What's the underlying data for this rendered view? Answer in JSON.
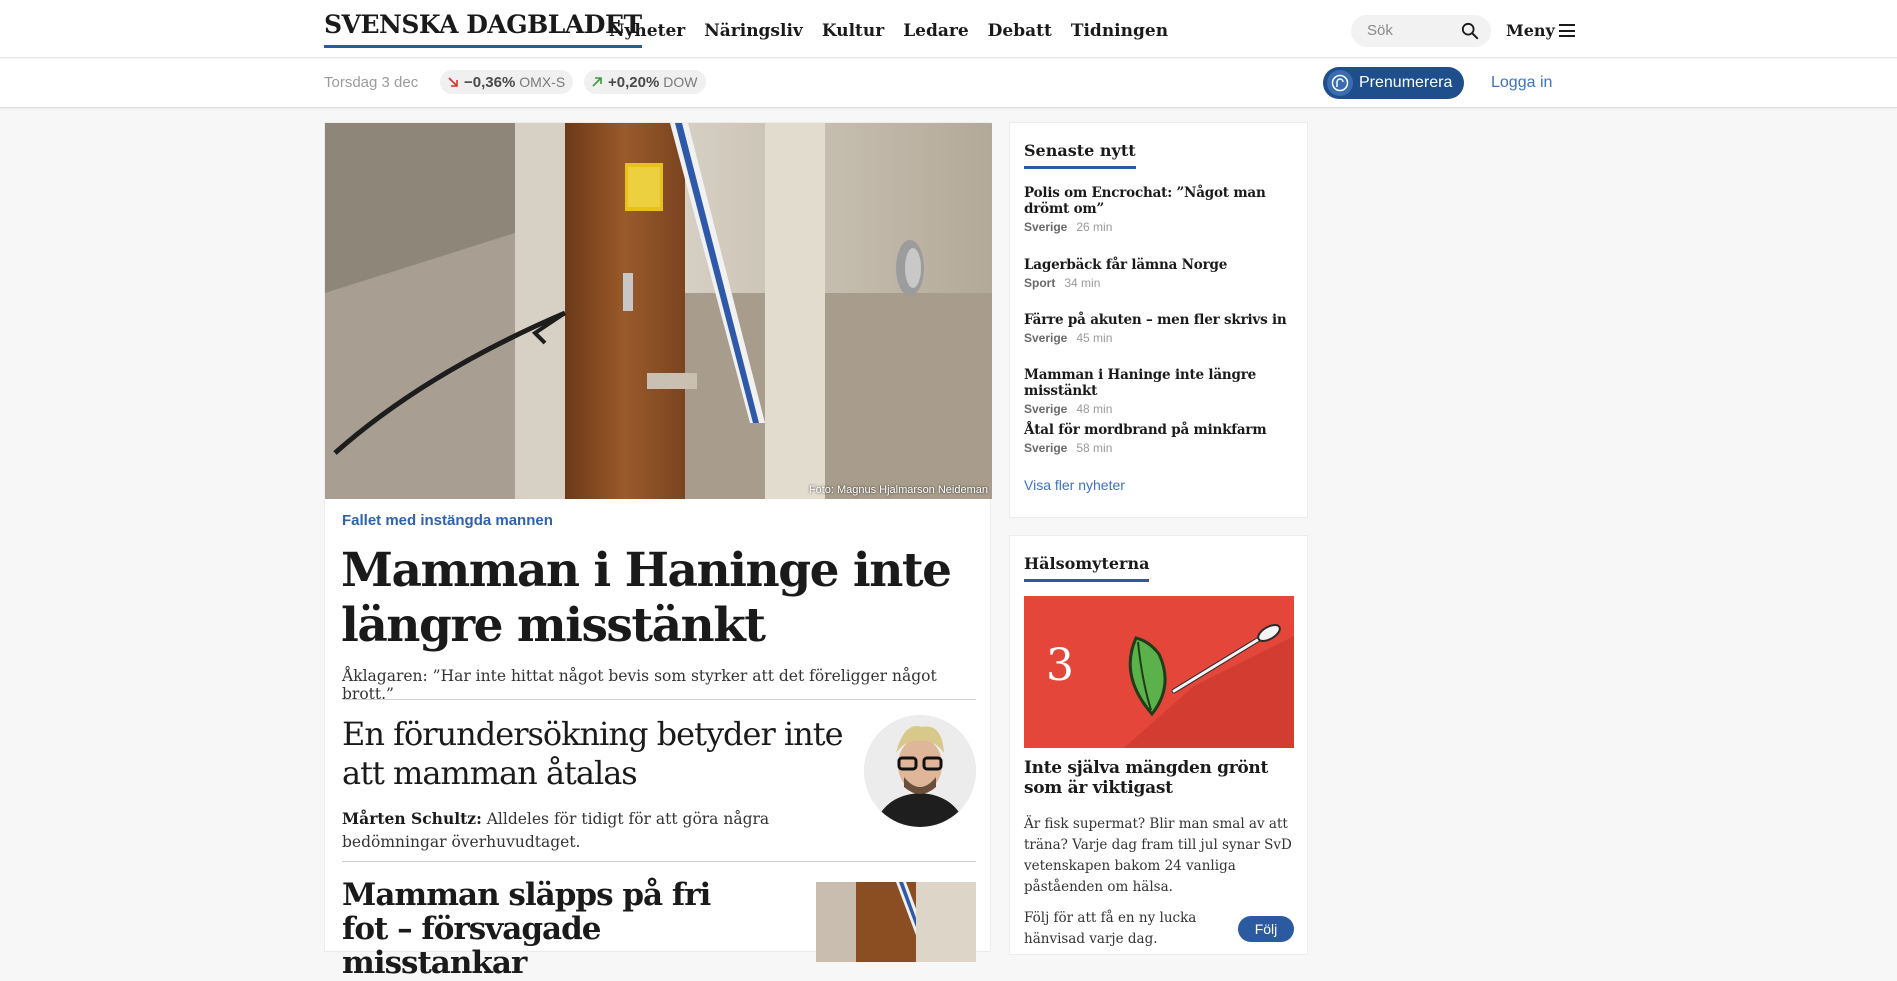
{
  "header": {
    "logo": "SVENSKA DAGBLADET",
    "nav": [
      "Nyheter",
      "Näringsliv",
      "Kultur",
      "Ledare",
      "Debatt",
      "Tidningen"
    ],
    "search_placeholder": "Sök",
    "menu_label": "Meny"
  },
  "subbar": {
    "date": "Torsdag 3 dec",
    "tickers": [
      {
        "value": "−0,36%",
        "name": "OMX-S",
        "direction": "down",
        "color": "#d0342c"
      },
      {
        "value": "+0,20%",
        "name": "DOW",
        "direction": "up",
        "color": "#3a9a3a"
      }
    ],
    "subscribe_label": "Prenumerera",
    "login_label": "Logga in"
  },
  "main": {
    "photo_credit": "Foto: Magnus Hjalmarson Neideman",
    "kicker": "Fallet med instängda mannen",
    "headline": "Mamman i Haninge inte längre misstänkt",
    "lead": "Åklagaren: ”Har inte hittat något bevis som styrker att det föreligger något brott.”",
    "sub_headline": "En förundersökning betyder inte att mamman åtalas",
    "sub_author": "Mårten Schultz:",
    "sub_lead": " Alldeles för tidigt för att göra några bedömningar överhuvudtaget.",
    "third_headline": "Mamman släpps på fri fot – försvagade misstankar"
  },
  "latest": {
    "title": "Senaste nytt",
    "items": [
      {
        "title": "Polis om Encrochat: ”Något man drömt om”",
        "category": "Sverige",
        "time": "26 min"
      },
      {
        "title": "Lagerbäck får lämna Norge",
        "category": "Sport",
        "time": "34 min"
      },
      {
        "title": "Färre på akuten – men fler skrivs in",
        "category": "Sverige",
        "time": "45 min"
      },
      {
        "title": "Mamman i Haninge inte längre misstänkt",
        "category": "Sverige",
        "time": "48 min"
      },
      {
        "title": "Åtal för mordbrand på minkfarm",
        "category": "Sverige",
        "time": "58 min"
      }
    ],
    "more_label": "Visa fler nyheter"
  },
  "health": {
    "title": "Hälsomyterna",
    "promo_number": "3",
    "promo_title": "Inte själva mängden grönt som är viktigast",
    "promo_text": "Är fisk supermat? Blir man smal av att träna? Varje dag fram till jul synar SvD vetenskapen bakom 24 vanliga påståenden om hälsa.",
    "follow_text": "Följ för att få en ny lucka hänvisad varje dag.",
    "follow_label": "Följ"
  },
  "colors": {
    "brand_blue": "#2c5aa0",
    "link_blue": "#3f72c0",
    "promo_red": "#e4463a"
  }
}
